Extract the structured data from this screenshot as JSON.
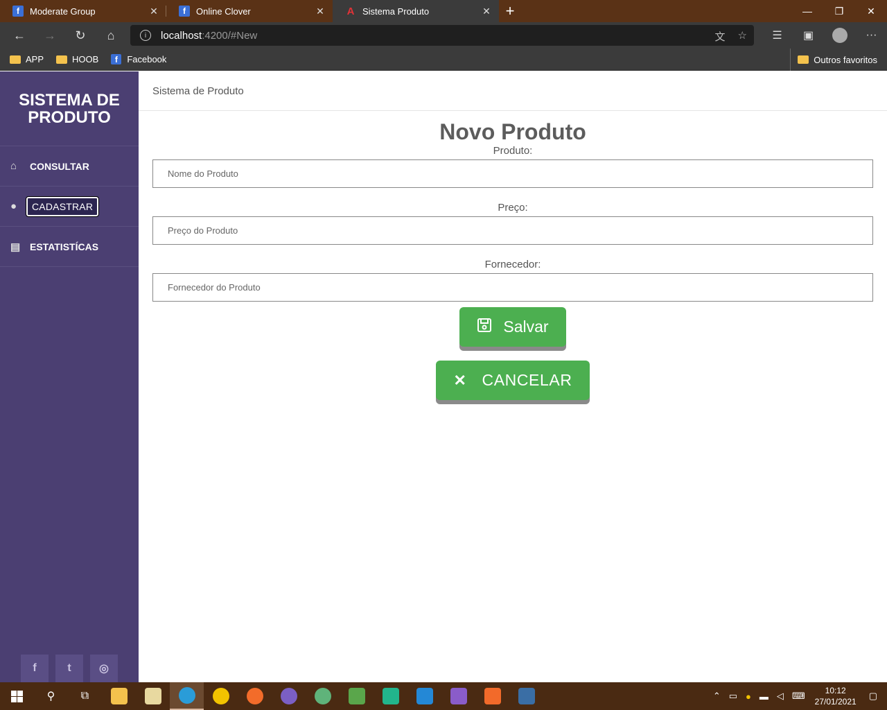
{
  "browser": {
    "tabs": [
      {
        "title": "Moderate Group",
        "favicon": "facebook-icon",
        "active": false
      },
      {
        "title": "Online Clover",
        "favicon": "facebook-icon",
        "active": false
      },
      {
        "title": "Sistema Produto",
        "favicon": "angular-icon",
        "active": true
      }
    ],
    "url_host": "localhost",
    "url_path": ":4200/#New",
    "bookmarks": [
      {
        "label": "APP",
        "icon": "folder-icon"
      },
      {
        "label": "HOOB",
        "icon": "folder-icon"
      },
      {
        "label": "Facebook",
        "icon": "facebook-icon"
      }
    ],
    "other_favorites": "Outros favoritos"
  },
  "sidebar": {
    "brand": "SISTEMA DE PRODUTO",
    "items": [
      {
        "label": "CONSULTAR",
        "icon": "home-icon"
      },
      {
        "label": "CADASTRAR",
        "icon": "user-icon",
        "active": true
      },
      {
        "label": "ESTATISTÍCAS",
        "icon": "id-card-icon"
      }
    ],
    "social": [
      "facebook-icon",
      "twitter-icon",
      "instagram-icon"
    ]
  },
  "header": {
    "title": "Sistema de Produto"
  },
  "form": {
    "title": "Novo Produto",
    "fields": [
      {
        "label": "Produto:",
        "placeholder": "Nome do Produto"
      },
      {
        "label": "Preço:",
        "placeholder": "Preço do Produto"
      },
      {
        "label": "Fornecedor:",
        "placeholder": "Fornecedor do Produto"
      }
    ],
    "save_label": "Salvar",
    "cancel_label": "CANCELAR"
  },
  "taskbar": {
    "time": "10:12",
    "date": "27/01/2021"
  },
  "colors": {
    "sidebar": "#4b3f72",
    "button_green": "#4caf50",
    "tabbar": "#5a3216"
  }
}
